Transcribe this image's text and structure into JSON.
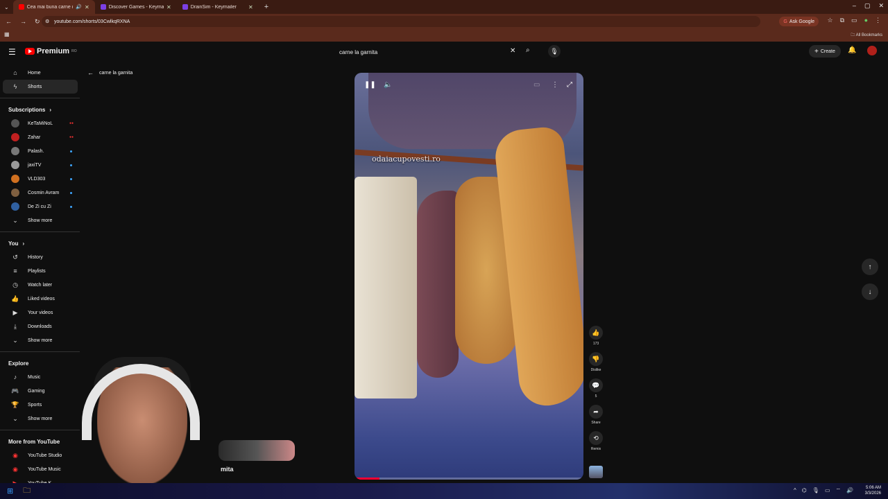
{
  "browser": {
    "tabs": [
      {
        "title": "Cea mai buna carne de po:",
        "active": true,
        "favicon_color": "#ff0000"
      },
      {
        "title": "Discover Games - Keymailer",
        "active": false,
        "favicon_color": "#7b3fe4"
      },
      {
        "title": "DrainSim - Keymailer",
        "active": false,
        "favicon_color": "#7b3fe4"
      }
    ],
    "new_tab": "+",
    "url": "youtube.com/shorts/03CwlkqRXNA",
    "ask_google": "Ask Google",
    "all_bookmarks": "All Bookmarks"
  },
  "header": {
    "logo_text": "Premium",
    "logo_region": "RO",
    "search_value": "carne la garnita",
    "create_label": "Create"
  },
  "sidebar": {
    "main": [
      {
        "label": "Home",
        "icon": "home-icon",
        "glyph": "⌂"
      },
      {
        "label": "Shorts",
        "icon": "shorts-icon",
        "glyph": "ϟ",
        "active": true
      }
    ],
    "subscriptions_title": "Subscriptions",
    "subscriptions": [
      {
        "label": "KeTaMiNoL",
        "color": "#555",
        "live": true
      },
      {
        "label": "Zahar",
        "color": "#c02020",
        "live": true
      },
      {
        "label": "Palash.",
        "color": "#777",
        "dot": true
      },
      {
        "label": "jaxiTV",
        "color": "#999",
        "dot": true
      },
      {
        "label": "VLD303",
        "color": "#d07020",
        "dot": true
      },
      {
        "label": "Cosmin Avram",
        "color": "#806040",
        "dot": true
      },
      {
        "label": "De Zi cu Zi",
        "color": "#3060a0",
        "dot": true
      }
    ],
    "show_more": "Show more",
    "you_title": "You",
    "you": [
      {
        "label": "History",
        "glyph": "↺"
      },
      {
        "label": "Playlists",
        "glyph": "≡"
      },
      {
        "label": "Watch later",
        "glyph": "◷"
      },
      {
        "label": "Liked videos",
        "glyph": "👍"
      },
      {
        "label": "Your videos",
        "glyph": "▶"
      },
      {
        "label": "Downloads",
        "glyph": "⤓"
      }
    ],
    "explore_title": "Explore",
    "explore": [
      {
        "label": "Music",
        "glyph": "♪"
      },
      {
        "label": "Gaming",
        "glyph": "🎮"
      },
      {
        "label": "Sports",
        "glyph": "🏆"
      }
    ],
    "more_title": "More from YouTube",
    "more": [
      {
        "label": "YouTube Studio"
      },
      {
        "label": "YouTube Music"
      },
      {
        "label": "YouTube K"
      }
    ]
  },
  "back_label": "carne la garnita",
  "video": {
    "watermark": "odaiacupovesti.ro",
    "progress": 0.11
  },
  "actions": {
    "like_count": "173",
    "dislike_label": "Dislike",
    "comment_count": "5",
    "share_label": "Share",
    "remix_label": "Remix"
  },
  "webcam_overlay_text": "mita",
  "taskbar": {
    "time": "5:06 AM",
    "date": "3/3/2026"
  }
}
